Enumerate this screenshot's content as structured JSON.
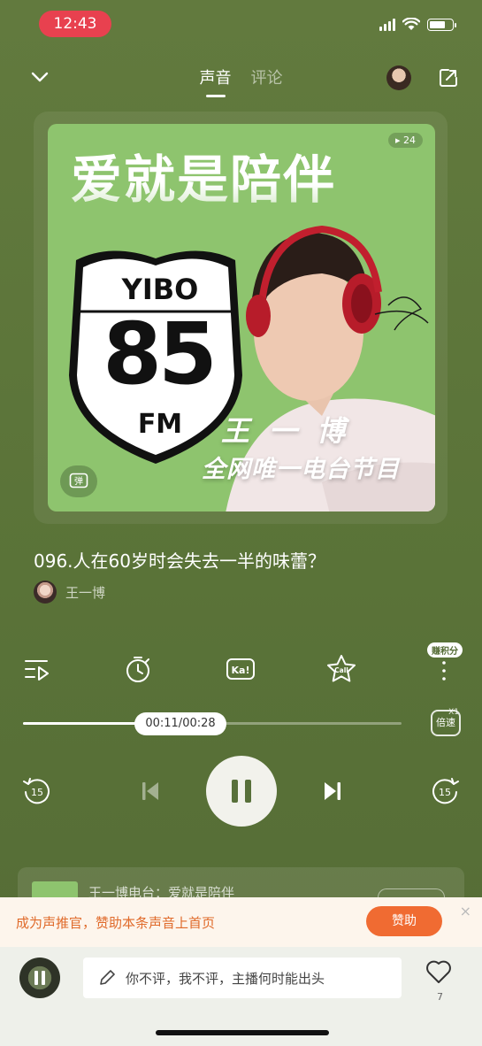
{
  "status_bar": {
    "time": "12:43"
  },
  "header": {
    "tabs": [
      "声音",
      "评论"
    ],
    "active_tab": "声音"
  },
  "cover": {
    "title": "爱就是陪伴",
    "play_count": "24",
    "shield_top": "YIBO",
    "shield_number": "85",
    "shield_bottom": "FM",
    "name": "王一博",
    "subtitle": "全网唯一电台节目",
    "danmaku_icon": "弹"
  },
  "track": {
    "title": "096.人在60岁时会失去一半的味蕾？",
    "author": "王一博"
  },
  "tools": {
    "more_badge": "赚积分",
    "icons": [
      "playlist-icon",
      "timer-icon",
      "karaoke-icon",
      "call-icon",
      "more-icon"
    ],
    "karaoke_label": "Ka!",
    "call_label": "Call"
  },
  "progress": {
    "time_label": "00:11/00:28",
    "fraction": 0.393
  },
  "speed": {
    "label": "倍速",
    "value": "X1"
  },
  "controls": {
    "rewind_label": "15",
    "forward_label": "15"
  },
  "mini_card": {
    "text": "王一博电台：爱就是陪伴"
  },
  "promo": {
    "text": "成为声推官，赞助本条声音上首页",
    "button": "赞助",
    "close": "×"
  },
  "comment_bar": {
    "placeholder": "你不评，我不评，主播何时能出头",
    "like_count": "7"
  },
  "colors": {
    "accent": "#f06b32",
    "background": "#5a7338",
    "cover_green": "#8ec46e"
  }
}
